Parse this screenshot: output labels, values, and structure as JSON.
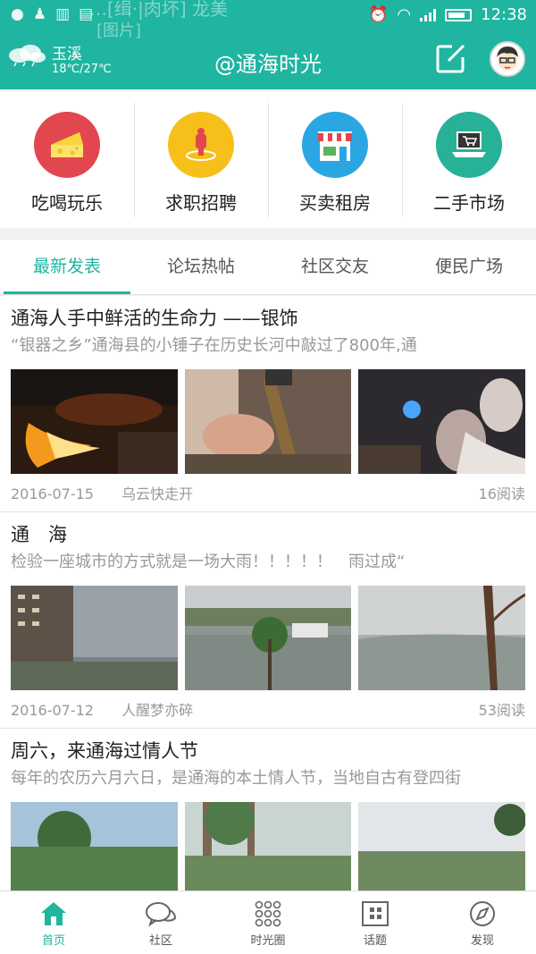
{
  "status_bar": {
    "time": "12:38",
    "ghost_text_line1": "…[缉·|肉坏] 龙美",
    "ghost_text_line2": "[图片]",
    "ghost_time": "12:38"
  },
  "header": {
    "title": "@通海时光",
    "weather_city": "玉溪",
    "weather_temp": "18℃/27℃",
    "accent": "#1fb5a0"
  },
  "categories": [
    {
      "label": "吃喝玩乐",
      "icon": "cheese-icon",
      "color": "#e2474f"
    },
    {
      "label": "求职招聘",
      "icon": "job-pin-icon",
      "color": "#f7bf1a"
    },
    {
      "label": "买卖租房",
      "icon": "shop-icon",
      "color": "#2aa7e3"
    },
    {
      "label": "二手市场",
      "icon": "laptop-cart-icon",
      "color": "#27b297"
    }
  ],
  "tabs": [
    "最新发表",
    "论坛热帖",
    "社区交友",
    "便民广场"
  ],
  "posts": [
    {
      "title": "通海人手中鲜活的生命力 ——银饰",
      "summary": "“银器之乡”通海县的小锤子在历史长河中敲过了800年,通",
      "date": "2016-07-15",
      "author": "乌云快走开",
      "reads": "16阅读"
    },
    {
      "title": "通　海",
      "summary": "检验一座城市的方式就是一场大雨！！！！！　雨过成“",
      "date": "2016-07-12",
      "author": "人醒梦亦碎",
      "reads": "53阅读"
    },
    {
      "title": "周六，来通海过情人节",
      "summary": "每年的农历六月六日，是通海的本土情人节，当地自古有登四街"
    }
  ],
  "bottom_nav": [
    "首页",
    "社区",
    "时光圈",
    "话题",
    "发现"
  ]
}
